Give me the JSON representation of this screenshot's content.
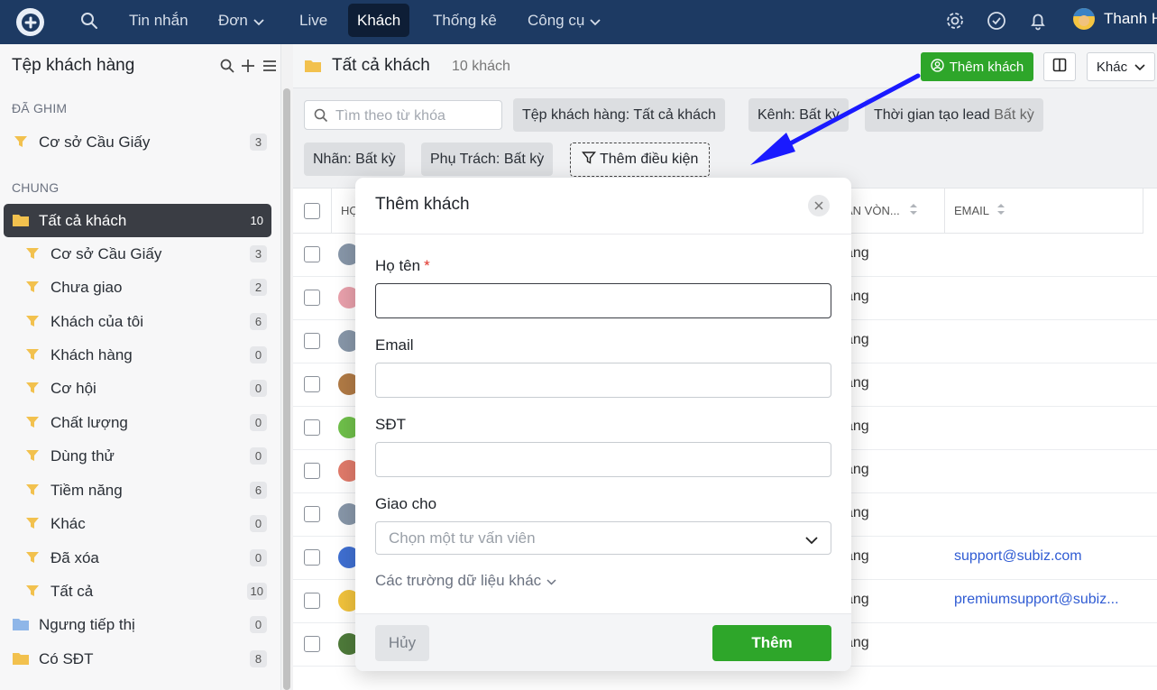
{
  "topnav": {
    "items": [
      {
        "label": "Tin nhắn"
      },
      {
        "label": "Đơn"
      },
      {
        "label": "Live"
      },
      {
        "label": "Khách"
      },
      {
        "label": "Thống kê"
      },
      {
        "label": "Công cụ"
      }
    ],
    "user_name": "Thanh H"
  },
  "sidebar": {
    "title": "Tệp khách hàng",
    "pinned_section": "ĐÃ GHIM",
    "pinned": [
      {
        "label": "Cơ sở Cầu Giấy",
        "count": "3"
      }
    ],
    "general_section": "CHUNG",
    "items": [
      {
        "label": "Tất cả khách",
        "count": "10"
      },
      {
        "label": "Cơ sở Cầu Giấy",
        "count": "3"
      },
      {
        "label": "Chưa giao",
        "count": "2"
      },
      {
        "label": "Khách của tôi",
        "count": "6"
      },
      {
        "label": "Khách hàng",
        "count": "0"
      },
      {
        "label": "Cơ hội",
        "count": "0"
      },
      {
        "label": "Chất lượng",
        "count": "0"
      },
      {
        "label": "Dùng thử",
        "count": "0"
      },
      {
        "label": "Tiềm năng",
        "count": "6"
      },
      {
        "label": "Khác",
        "count": "0"
      },
      {
        "label": "Đã xóa",
        "count": "0"
      },
      {
        "label": "Tất cả",
        "count": "10"
      },
      {
        "label": "Ngưng tiếp thị",
        "count": "0"
      },
      {
        "label": "Có SĐT",
        "count": "8"
      }
    ]
  },
  "main": {
    "title": "Tất cả khách",
    "count": "10 khách",
    "add_button": "Thêm khách",
    "more_button": "Khác",
    "search_placeholder": "Tìm theo từ khóa",
    "chips": {
      "segment": "Tệp khách hàng: Tất cả khách",
      "channel": "Kênh: Bất kỳ",
      "lead_time_label": "Thời gian tạo lead",
      "lead_time_value": "Bất kỳ",
      "tag": "Nhãn: Bất kỳ",
      "owner": "Phụ Trách: Bất kỳ",
      "add_condition": "Thêm điều kiện"
    },
    "columns": {
      "name": "HỌ",
      "stage": "ẠN VÒN...",
      "email": "EMAIL"
    },
    "rows": [
      {
        "stage": "ăng",
        "email": ""
      },
      {
        "stage": "ăng",
        "email": ""
      },
      {
        "stage": "ăng",
        "email": ""
      },
      {
        "stage": "ăng",
        "email": ""
      },
      {
        "stage": "ăng",
        "email": ""
      },
      {
        "stage": "ăng",
        "email": ""
      },
      {
        "stage": "ăng",
        "email": ""
      },
      {
        "stage": "ăng",
        "email": "support@subiz.com"
      },
      {
        "stage": "ăng",
        "email": "premiumsupport@subiz..."
      },
      {
        "stage": "ăng",
        "email": ""
      }
    ]
  },
  "modal": {
    "title": "Thêm khách",
    "name_label": "Họ tên",
    "required_mark": "*",
    "name_value": "",
    "email_label": "Email",
    "email_value": "",
    "phone_label": "SĐT",
    "phone_value": "",
    "assign_label": "Giao cho",
    "assign_placeholder": "Chọn một tư vấn viên",
    "more_fields": "Các trường dữ liệu khác",
    "cancel": "Hủy",
    "submit": "Thêm"
  },
  "colors": {
    "nav_bg": "#1d3a63",
    "primary_green": "#2ea62a",
    "arrow_blue": "#1a1aff",
    "link_blue": "#2f5bd3"
  }
}
